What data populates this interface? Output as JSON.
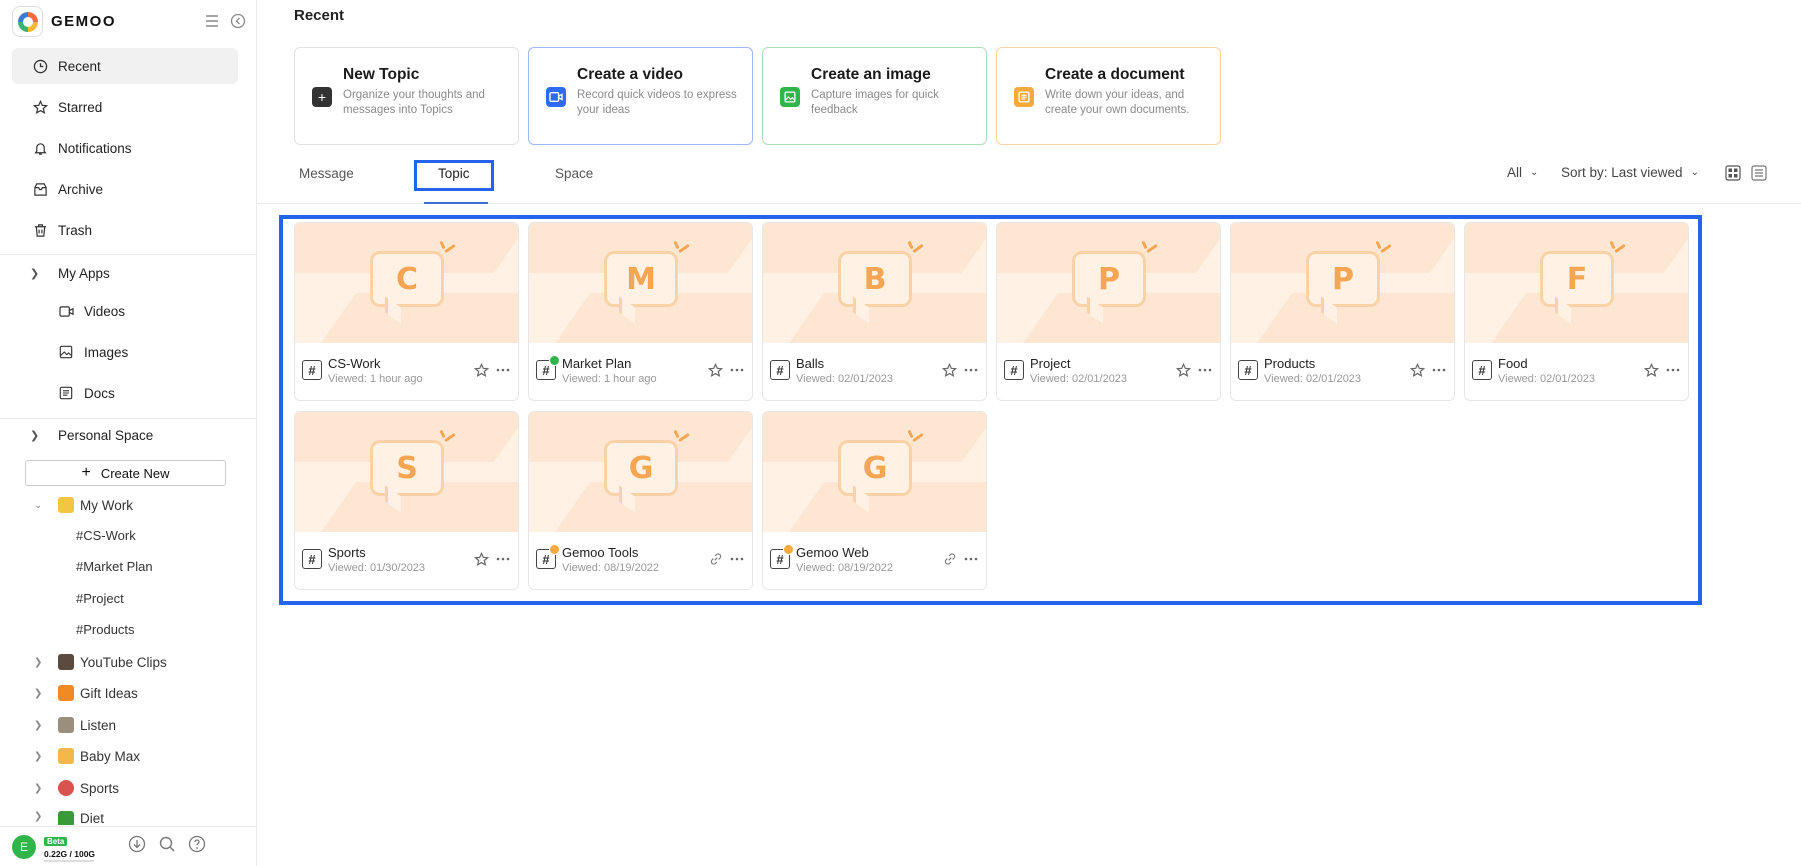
{
  "app": {
    "name": "GEMOO"
  },
  "sidebar": {
    "nav": [
      {
        "label": "Recent",
        "icon": "clock-icon"
      },
      {
        "label": "Starred",
        "icon": "star-icon"
      },
      {
        "label": "Notifications",
        "icon": "bell-icon"
      },
      {
        "label": "Archive",
        "icon": "archive-icon"
      },
      {
        "label": "Trash",
        "icon": "trash-icon"
      }
    ],
    "my_apps": {
      "label": "My Apps",
      "items": [
        {
          "label": "Videos",
          "icon": "video-icon"
        },
        {
          "label": "Images",
          "icon": "image-icon"
        },
        {
          "label": "Docs",
          "icon": "doc-icon"
        }
      ]
    },
    "personal_space": {
      "label": "Personal Space",
      "create_new": "Create New",
      "my_work": "My Work",
      "tags": [
        "#CS-Work",
        "#Market Plan",
        "#Project",
        "#Products"
      ],
      "folders": [
        {
          "label": "YouTube Clips",
          "color": "#5b4a3f"
        },
        {
          "label": "Gift Ideas",
          "color": "#f08a24"
        },
        {
          "label": "Listen",
          "color": "#9a8f7d"
        },
        {
          "label": "Baby Max",
          "color": "#f2b84b"
        },
        {
          "label": "Sports",
          "color": "#d9534f"
        },
        {
          "label": "Diet",
          "color": "#3a9a3a"
        }
      ]
    },
    "footer": {
      "avatar": "E",
      "beta": "Beta",
      "quota": "0.22G / 100G"
    }
  },
  "main": {
    "title": "Recent",
    "quick": [
      {
        "title": "New Topic",
        "desc": "Organize your thoughts and messages into Topics",
        "icon": "plus-icon",
        "color": "#333333",
        "border": "#e2e2e2"
      },
      {
        "title": "Create a video",
        "desc": "Record quick videos to express your ideas",
        "icon": "video-icon",
        "color": "#2f6bf0",
        "border": "#9cb9f2"
      },
      {
        "title": "Create an image",
        "desc": "Capture images for quick feedback",
        "icon": "image-icon",
        "color": "#2fb54a",
        "border": "#a9dfb5"
      },
      {
        "title": "Create a document",
        "desc": "Write down your ideas, and create your own documents.",
        "icon": "doc-icon",
        "color": "#f7a93b",
        "border": "#f7d3a3"
      }
    ],
    "tabs": [
      "Message",
      "Topic",
      "Space"
    ],
    "filter": "All",
    "sort": "Sort by: Last viewed",
    "topics": [
      {
        "letter": "C",
        "name": "CS-Work",
        "viewed": "Viewed: 1 hour ago",
        "action": "star"
      },
      {
        "letter": "M",
        "name": "Market Plan",
        "viewed": "Viewed: 1 hour ago",
        "action": "star",
        "badge": "#2fb54a"
      },
      {
        "letter": "B",
        "name": "Balls",
        "viewed": "Viewed: 02/01/2023",
        "action": "star"
      },
      {
        "letter": "P",
        "name": "Project",
        "viewed": "Viewed: 02/01/2023",
        "action": "star"
      },
      {
        "letter": "P",
        "name": "Products",
        "viewed": "Viewed: 02/01/2023",
        "action": "star"
      },
      {
        "letter": "F",
        "name": "Food",
        "viewed": "Viewed: 02/01/2023",
        "action": "star"
      },
      {
        "letter": "S",
        "name": "Sports",
        "viewed": "Viewed: 01/30/2023",
        "action": "star"
      },
      {
        "letter": "G",
        "name": "Gemoo Tools",
        "viewed": "Viewed: 08/19/2022",
        "action": "link",
        "badge": "#f7a93b"
      },
      {
        "letter": "G",
        "name": "Gemoo Web",
        "viewed": "Viewed: 08/19/2022",
        "action": "link",
        "badge": "#f7a93b"
      }
    ]
  }
}
